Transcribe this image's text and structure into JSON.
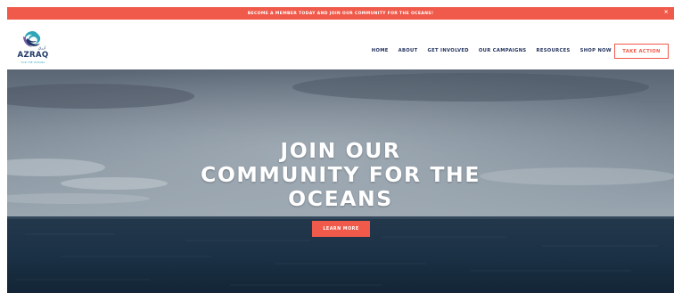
{
  "announcement": {
    "text": "BECOME A MEMBER TODAY AND JOIN OUR COMMUNITY FOR THE OCEANS!",
    "close_icon": "close-icon",
    "close_glyph": "×"
  },
  "brand": {
    "name": "AZRAQ",
    "arabic": "أزرق",
    "tagline": "FOR THE OCEANS",
    "logo_icon": "wave-logo-icon"
  },
  "nav": {
    "items": [
      {
        "label": "HOME"
      },
      {
        "label": "ABOUT"
      },
      {
        "label": "GET INVOLVED"
      },
      {
        "label": "OUR CAMPAIGNS"
      },
      {
        "label": "RESOURCES"
      },
      {
        "label": "SHOP NOW"
      }
    ],
    "cta_label": "TAKE ACTION"
  },
  "hero": {
    "title_lines": [
      "JOIN OUR",
      "COMMUNITY FOR THE",
      "OCEANS"
    ],
    "button_label": "LEARN MORE"
  },
  "colors": {
    "accent": "#f05a4a",
    "navy": "#1f2f5a",
    "teal": "#2fa6b8"
  }
}
